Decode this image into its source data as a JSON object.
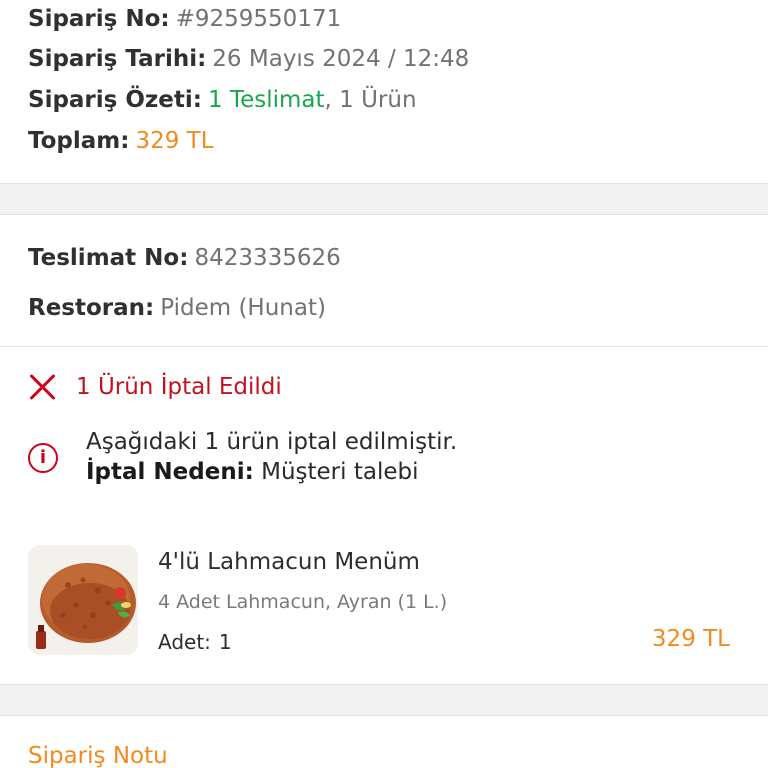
{
  "order": {
    "number_label": "Sipariş No:",
    "number_value": "#9259550171",
    "date_label": "Sipariş Tarihi:",
    "date_value": "26 Mayıs 2024 / 12:48",
    "summary_label": "Sipariş Özeti:",
    "summary_delivery": "1 Teslimat",
    "summary_items": ", 1 Ürün",
    "total_label": "Toplam:",
    "total_value": "329 TL"
  },
  "delivery": {
    "number_label": "Teslimat No:",
    "number_value": "8423335626",
    "restaurant_label": "Restoran:",
    "restaurant_value": "Pidem (Hunat)"
  },
  "cancellation": {
    "title": "1 Ürün İptal Edildi",
    "message": "Aşağıdaki 1 ürün iptal edilmiştir.",
    "reason_label": "İptal Nedeni:",
    "reason_value": "Müşteri talebi"
  },
  "product": {
    "name": "4'lü Lahmacun Menüm",
    "description": "4 Adet Lahmacun, Ayran (1 L.)",
    "qty_label": "Adet:",
    "qty_value": "1",
    "price": "329 TL",
    "image_icon": "lahmacun-image"
  },
  "note": {
    "title": "Sipariş Notu"
  },
  "colors": {
    "accent_orange": "#f28a1e",
    "success_green": "#1aa64a",
    "cancel_red": "#d0021b"
  }
}
